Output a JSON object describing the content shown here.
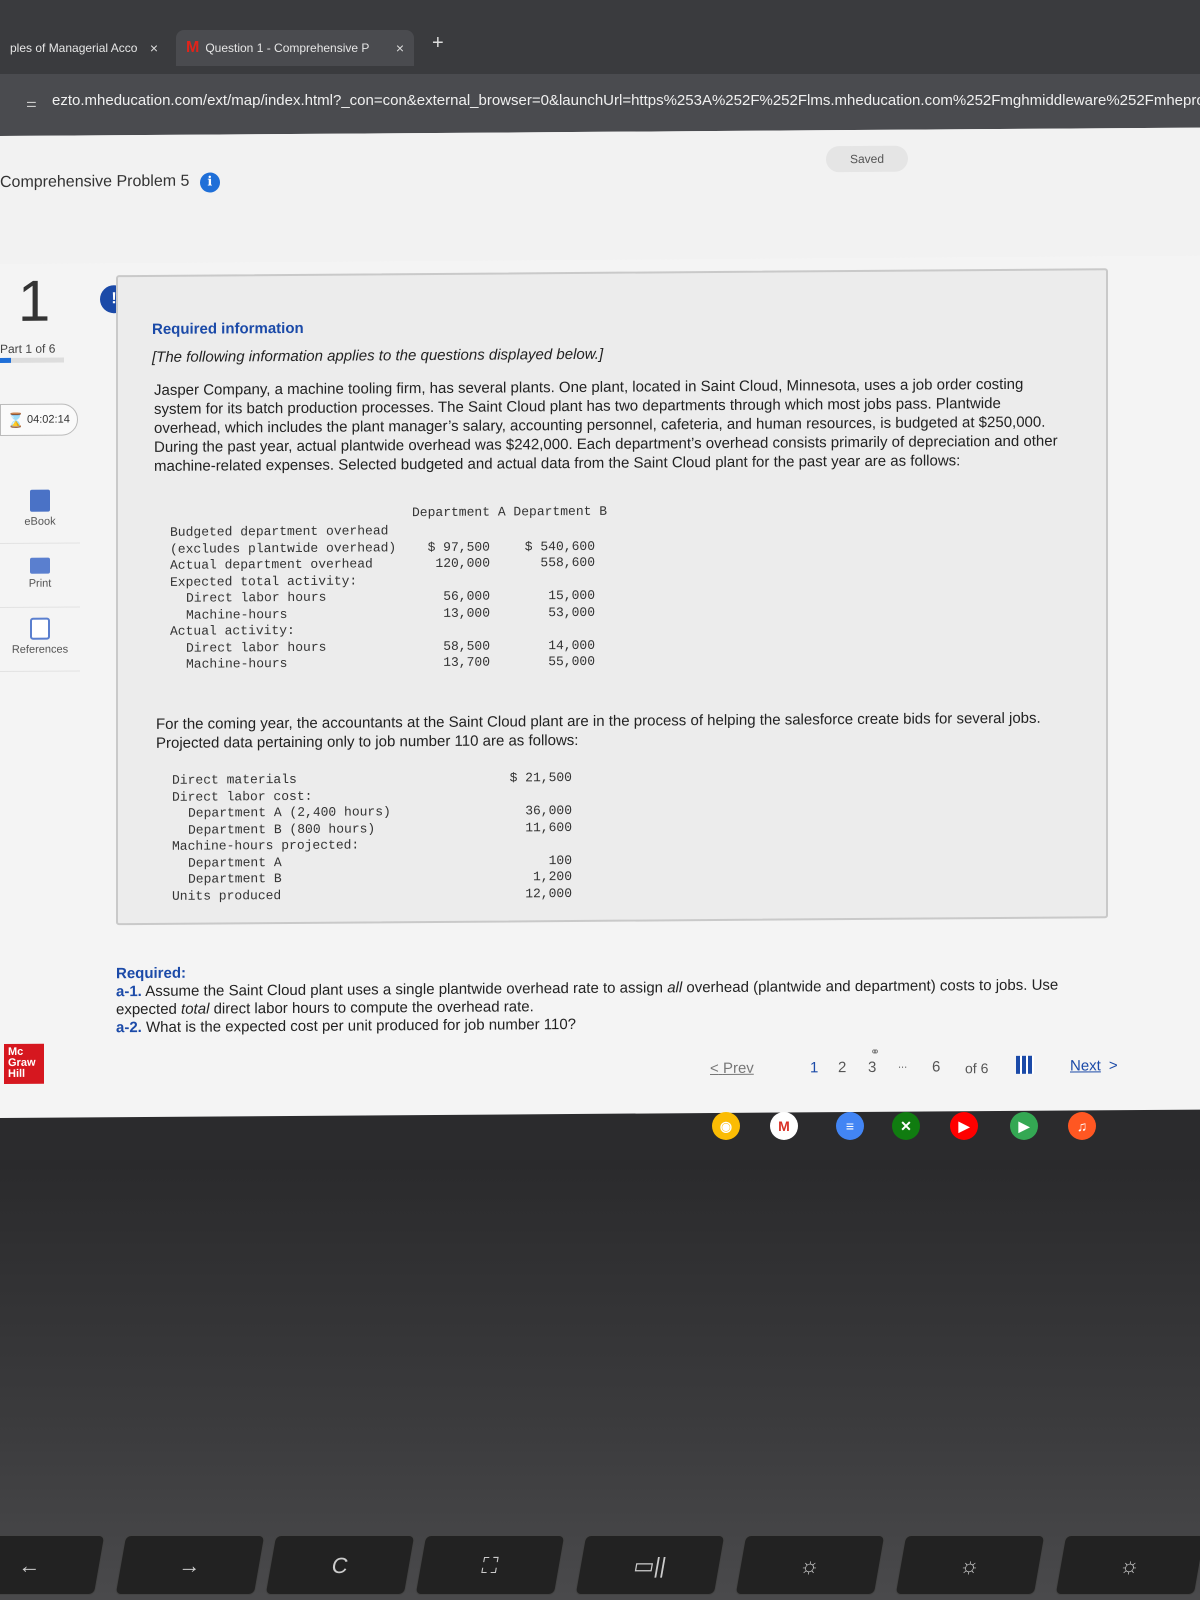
{
  "browser": {
    "tabs": [
      {
        "label": "ples of Managerial Acco",
        "active": false
      },
      {
        "label": "Question 1 - Comprehensive P",
        "active": true
      }
    ],
    "new_tab": "+",
    "tab_close": "×",
    "url": "ezto.mheducation.com/ext/map/index.html?_con=con&external_browser=0&launchUrl=https%253A%252F%252Flms.mheducation.com%252Fmghmiddleware%252Fmhepro"
  },
  "header": {
    "problem_title": "Comprehensive Problem 5",
    "info_icon": "i",
    "saved_label": "Saved"
  },
  "sidebar": {
    "question_number": "1",
    "part_label": "Part 1 of 6",
    "part_progress": 0.1667,
    "timer": "04:02:14",
    "buttons": [
      {
        "label": "eBook",
        "icon": "book-icon"
      },
      {
        "label": "Print",
        "icon": "printer-icon"
      },
      {
        "label": "References",
        "icon": "references-icon"
      }
    ],
    "logo_lines": [
      "Mc",
      "Graw",
      "Hill"
    ]
  },
  "content": {
    "alert_glyph": "!",
    "required_info": "Required information",
    "following_note": "[The following information applies to the questions displayed below.]",
    "intro": "Jasper Company, a machine tooling firm, has several plants. One plant, located in Saint Cloud, Minnesota, uses a job order costing system for its batch production processes. The Saint Cloud plant has two departments through which most jobs pass. Plantwide overhead, which includes the plant manager’s salary, accounting personnel, cafeteria, and human resources, is budgeted at $250,000. During the past year, actual plantwide overhead was $242,000. Each department’s overhead consists primarily of depreciation and other machine-related expenses. Selected budgeted and actual data from the Saint Cloud plant for the past year are as follows:",
    "table1": {
      "header": "Department A Department B",
      "rows": [
        {
          "label": "Budgeted department overhead",
          "a": "",
          "b": "",
          "indent": false
        },
        {
          "label": "(excludes plantwide overhead)",
          "a": "$ 97,500",
          "b": "$ 540,600",
          "indent": false
        },
        {
          "label": "Actual department overhead",
          "a": "120,000",
          "b": "558,600",
          "indent": false
        },
        {
          "label": "Expected total activity:",
          "a": "",
          "b": "",
          "indent": false
        },
        {
          "label": "Direct labor hours",
          "a": "56,000",
          "b": "15,000",
          "indent": true
        },
        {
          "label": "Machine-hours",
          "a": "13,000",
          "b": "53,000",
          "indent": true
        },
        {
          "label": "Actual activity:",
          "a": "",
          "b": "",
          "indent": false
        },
        {
          "label": "Direct labor hours",
          "a": "58,500",
          "b": "14,000",
          "indent": true
        },
        {
          "label": "Machine-hours",
          "a": "13,700",
          "b": "55,000",
          "indent": true
        }
      ]
    },
    "intro2": "For the coming year, the accountants at the Saint Cloud plant are in the process of helping the salesforce create bids for several jobs. Projected data pertaining only to job number 110 are as follows:",
    "table2": {
      "rows": [
        {
          "label": "Direct materials",
          "value": "$ 21,500",
          "indent": false
        },
        {
          "label": "Direct labor cost:",
          "value": "",
          "indent": false
        },
        {
          "label": "Department A (2,400 hours)",
          "value": "36,000",
          "indent": true
        },
        {
          "label": "Department B (800 hours)",
          "value": "11,600",
          "indent": true
        },
        {
          "label": "Machine-hours projected:",
          "value": "",
          "indent": false
        },
        {
          "label": "Department A",
          "value": "100",
          "indent": true
        },
        {
          "label": "Department B",
          "value": "1,200",
          "indent": true
        },
        {
          "label": "Units produced",
          "value": "12,000",
          "indent": false
        }
      ]
    }
  },
  "required": {
    "heading": "Required:",
    "a1_label": "a-1.",
    "a1_text_pre": " Assume the Saint Cloud plant uses a single plantwide overhead rate to assign ",
    "a1_italic": "all",
    "a1_text_mid": " overhead (plantwide and department) costs to jobs. Use expected ",
    "a1_italic2": "total",
    "a1_text_post": " direct labor hours to compute the overhead rate.",
    "a2_label": "a-2.",
    "a2_text": " What is the expected cost per unit produced for job number 110?"
  },
  "navigation": {
    "prev_label": "Prev",
    "pages": [
      "1",
      "2",
      "3",
      "...",
      "6"
    ],
    "current_page": "1",
    "of_label": "of 6",
    "next_label": "Next",
    "next_chevron": ">",
    "prev_chevron": "<"
  },
  "shelf": {
    "apps": [
      "chrome-icon",
      "gmail-icon",
      "docs-icon",
      "xbox-icon",
      "youtube-icon",
      "play-store-icon",
      "music-icon"
    ]
  },
  "keyboard": {
    "keys": [
      "←",
      "→",
      "C",
      "⛶",
      "▭||",
      "☼",
      "☼",
      "☼"
    ]
  }
}
